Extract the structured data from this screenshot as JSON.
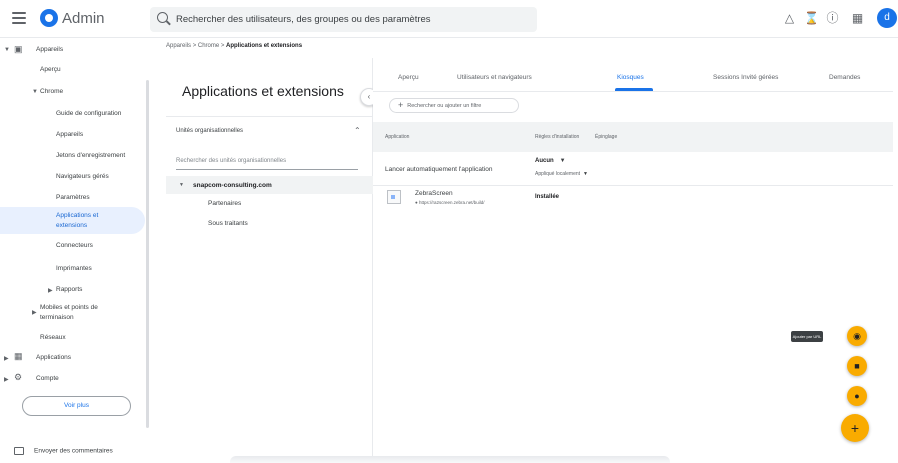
{
  "header": {
    "app_title": "Admin",
    "search_text": "Rechercher des utilisateurs, des groupes ou des paramètres",
    "avatar_letter": "d"
  },
  "sidebar": {
    "items": [
      {
        "label": "Appareils"
      },
      {
        "label": "Aperçu"
      },
      {
        "label": "Chrome"
      },
      {
        "label": "Guide de configuration"
      },
      {
        "label": "Appareils"
      },
      {
        "label": "Jetons d'enregistrement"
      },
      {
        "label": "Navigateurs gérés"
      },
      {
        "label": "Paramètres"
      },
      {
        "label": "Applications et"
      },
      {
        "label": "extensions"
      },
      {
        "label": "Connecteurs"
      },
      {
        "label": "Imprimantes"
      },
      {
        "label": "Rapports"
      },
      {
        "label": "Mobiles et points de"
      },
      {
        "label": "terminaison"
      },
      {
        "label": "Réseaux"
      },
      {
        "label": "Applications"
      },
      {
        "label": "Compte"
      }
    ],
    "voir_plus": "Voir plus",
    "feedback": "Envoyer des commentaires"
  },
  "breadcrumb": {
    "part1": "Appareils",
    "part2": "Chrome",
    "current": "Applications et extensions"
  },
  "ou_panel": {
    "title": "Applications et extensions",
    "header": "Unités organisationnelles",
    "search_placeholder": "Rechercher des unités organisationnelles",
    "root": "snapcom-consulting.com",
    "children": [
      "Partenaires",
      "Sous traitants"
    ]
  },
  "tabs": [
    {
      "label": "Aperçu"
    },
    {
      "label": "Utilisateurs et navigateurs"
    },
    {
      "label": "Kiosques"
    },
    {
      "label": "Sessions Invité gérées"
    },
    {
      "label": "Demandes"
    }
  ],
  "filter_chip": "Rechercher ou ajouter un filtre",
  "table": {
    "headers": [
      "Application",
      "Règles d'installation",
      "Épinglage"
    ],
    "rows": [
      {
        "app": "Lancer automatiquement l'application",
        "rule": "Aucun",
        "rule_sub": "Appliqué localement"
      },
      {
        "app": "ZebraScreen",
        "link": "https://ra2screen.zebra.net/build/",
        "rule": "Installée"
      }
    ]
  },
  "fab": {
    "tooltip": "Ajouter par URL"
  }
}
